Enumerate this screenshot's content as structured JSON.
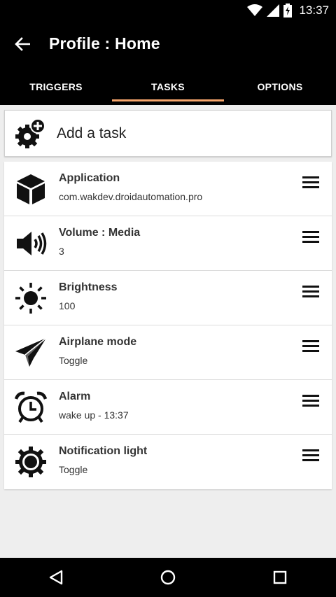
{
  "status_bar": {
    "time": "13:37",
    "icons": [
      "wifi-icon",
      "signal-icon",
      "battery-charging-icon"
    ]
  },
  "app_bar": {
    "title": "Profile : Home",
    "back_icon": "arrow-left-icon"
  },
  "tabs": [
    {
      "label": "TRIGGERS",
      "active": false
    },
    {
      "label": "TASKS",
      "active": true
    },
    {
      "label": "OPTIONS",
      "active": false
    }
  ],
  "add_task": {
    "label": "Add a task",
    "icon": "gear-plus-icon"
  },
  "tasks": [
    {
      "title": "Application",
      "subtitle": "com.wakdev.droidautomation.pro",
      "icon": "cube-icon"
    },
    {
      "title": "Volume : Media",
      "subtitle": "3",
      "icon": "speaker-icon"
    },
    {
      "title": "Brightness",
      "subtitle": "100",
      "icon": "sun-icon"
    },
    {
      "title": "Airplane mode",
      "subtitle": "Toggle",
      "icon": "paper-plane-icon"
    },
    {
      "title": "Alarm",
      "subtitle": "wake up - 13:37",
      "icon": "alarm-clock-icon"
    },
    {
      "title": "Notification light",
      "subtitle": "Toggle",
      "icon": "notification-light-icon"
    }
  ],
  "accent_color": "#f5a46a"
}
